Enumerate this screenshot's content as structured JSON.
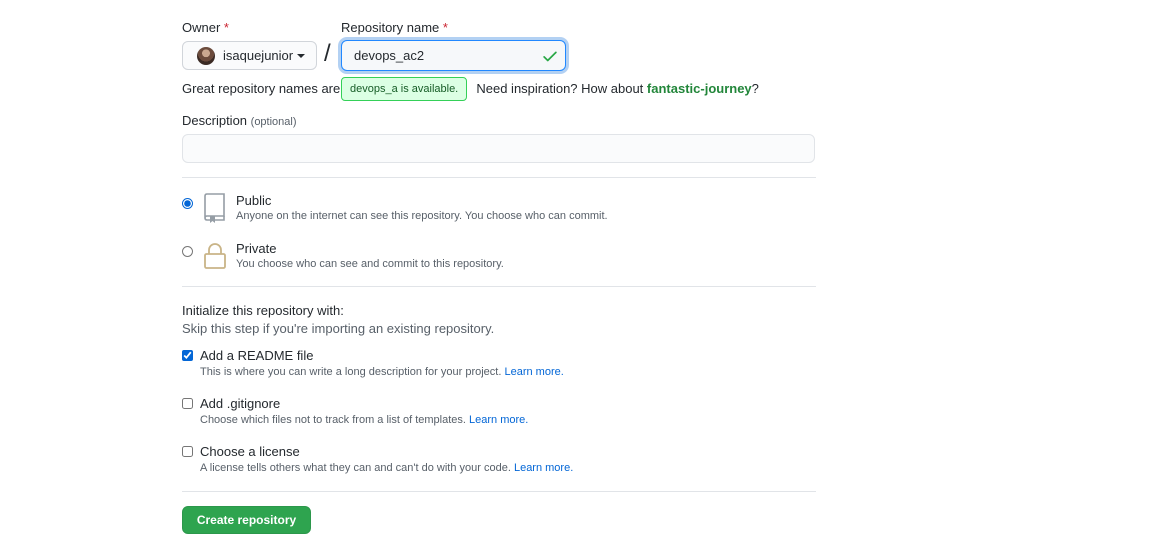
{
  "owner": {
    "label": "Owner",
    "required_mark": "*",
    "username": "isaquejunior"
  },
  "slash": "/",
  "repository": {
    "label": "Repository name",
    "required_mark": "*",
    "value": "devops_ac2",
    "availability_tooltip": "devops_a is available.",
    "hint_prefix": "Great repository names are s",
    "hint_middle": "Need inspiration? How about",
    "suggestion": "fantastic-journey",
    "hint_suffix": "?"
  },
  "description": {
    "label": "Description",
    "optional": "(optional)",
    "value": ""
  },
  "visibility": {
    "public": {
      "title": "Public",
      "note": "Anyone on the internet can see this repository. You choose who can commit.",
      "selected": true
    },
    "private": {
      "title": "Private",
      "note": "You choose who can see and commit to this repository.",
      "selected": false
    }
  },
  "initialize": {
    "heading": "Initialize this repository with:",
    "subheading": "Skip this step if you're importing an existing repository.",
    "readme": {
      "title": "Add a README file",
      "note": "This is where you can write a long description for your project.",
      "link": "Learn more.",
      "checked": true
    },
    "gitignore": {
      "title": "Add .gitignore",
      "note": "Choose which files not to track from a list of templates.",
      "link": "Learn more.",
      "checked": false
    },
    "license": {
      "title": "Choose a license",
      "note": "A license tells others what they can and can't do with your code.",
      "link": "Learn more.",
      "checked": false
    }
  },
  "create_button": "Create repository",
  "colors": {
    "accent": "#0366d6",
    "success": "#2ea44f",
    "suggestion": "#22863a",
    "tooltip_bg": "#dcffe4"
  }
}
